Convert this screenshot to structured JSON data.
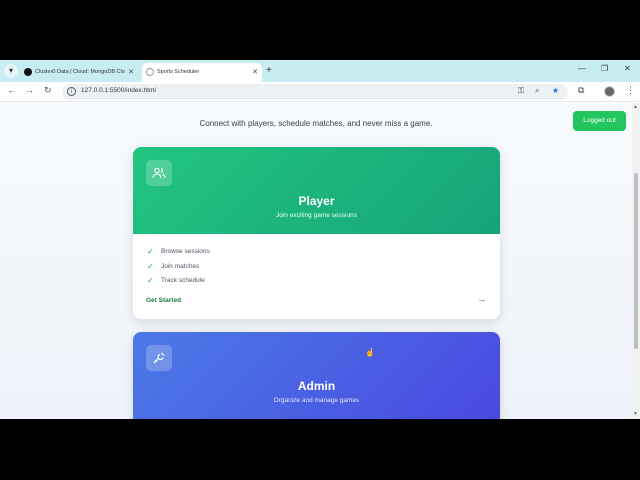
{
  "browser": {
    "tabs": [
      {
        "title": "Cluster0 Data | Cloud: MongoDB Clo"
      },
      {
        "title": "Sports Scheduler"
      }
    ],
    "url": "127.0.0.1:5500/index.html"
  },
  "page": {
    "subtitle": "Connect with players, schedule matches, and never miss a game.",
    "logout_label": "Logged out",
    "player_card": {
      "title": "Player",
      "subtitle": "Join exciting game sessions",
      "features": [
        "Browse sessions",
        "Join matches",
        "Track schedule"
      ],
      "cta": "Get Started"
    },
    "admin_card": {
      "title": "Admin",
      "subtitle": "Organize and manage games"
    }
  },
  "colors": {
    "player_accent": "#22c580",
    "admin_accent": "#4a48e0",
    "logout_button": "#22c55e"
  },
  "icons": {
    "player": "users-icon",
    "admin": "wrench-icon"
  }
}
